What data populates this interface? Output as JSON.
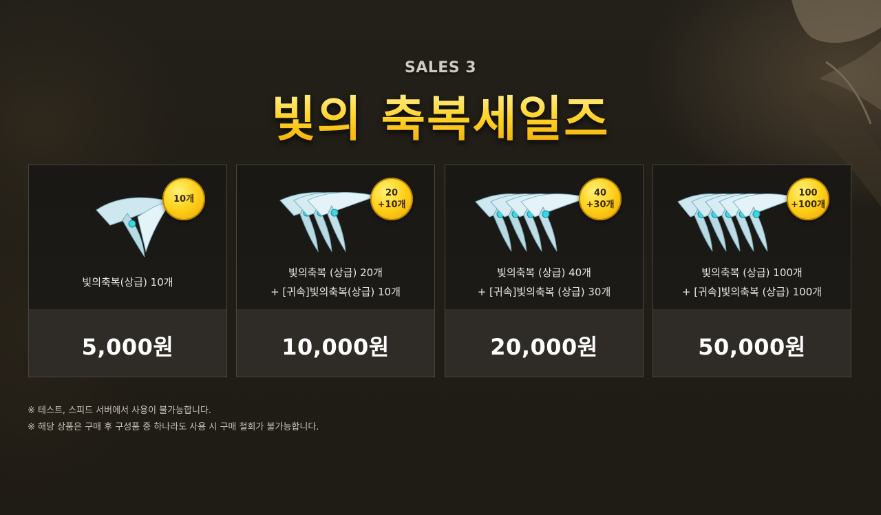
{
  "header": {
    "subtitle": "SALES 3",
    "title": "빛의 축복세일즈"
  },
  "products": [
    {
      "badge_lines": [
        "10개"
      ],
      "desc_lines": [
        "빛의축복(상급) 10개"
      ],
      "price": "5,000원",
      "feather_count": 1
    },
    {
      "badge_lines": [
        "20",
        "+10개"
      ],
      "desc_lines": [
        "빛의축복 (상급) 20개",
        "+ [귀속]빛의축복(상급) 10개"
      ],
      "price": "10,000원",
      "feather_count": 3
    },
    {
      "badge_lines": [
        "40",
        "+30개"
      ],
      "desc_lines": [
        "빛의축복 (상급) 40개",
        "+ [귀속]빛의축복 (상급) 30개"
      ],
      "price": "20,000원",
      "feather_count": 4
    },
    {
      "badge_lines": [
        "100",
        "+100개"
      ],
      "desc_lines": [
        "빛의축복 (상급) 100개",
        "+ [귀속]빛의축복 (상급) 100개"
      ],
      "price": "50,000원",
      "feather_count": 5
    }
  ],
  "notes": [
    "※ 테스트, 스피드 서버에서 사용이 불가능합니다.",
    "※ 해당 상품은 구매 후 구성품 중 하나라도 사용 시 구매 철회가 불가능합니다."
  ],
  "colors": {
    "accent_gold": "#ffd21a",
    "badge_gold": "#ffd21c",
    "background": "#211d17"
  },
  "icons": {
    "feather": "light-blessing-feather-icon"
  }
}
